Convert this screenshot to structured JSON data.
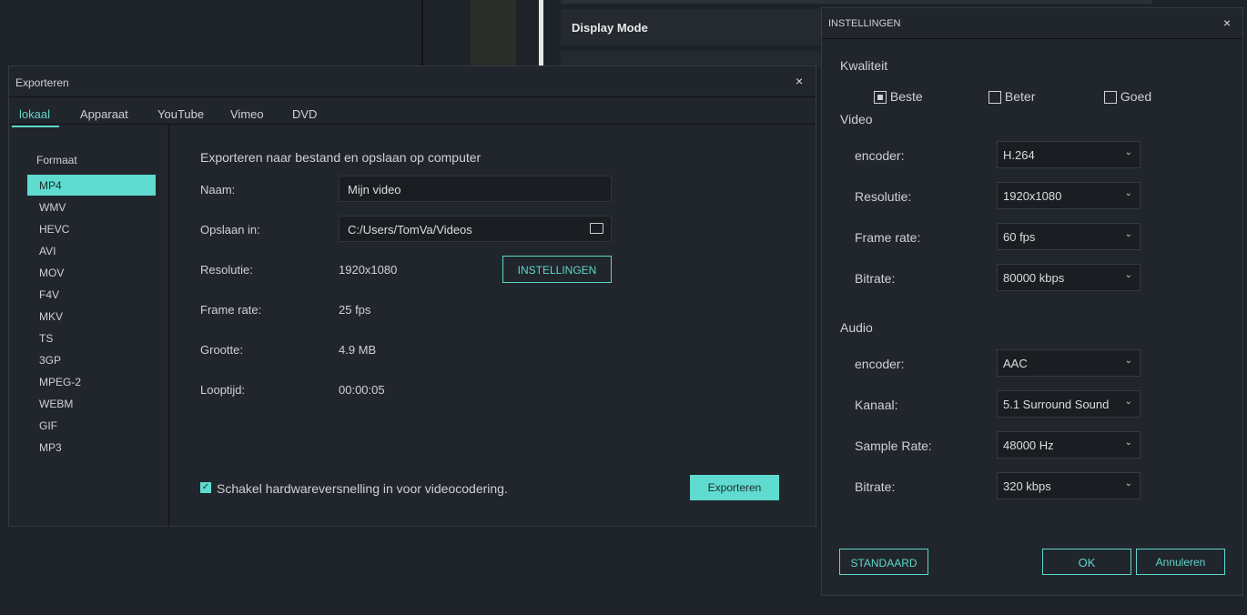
{
  "background": {
    "display_mode": "Display Mode"
  },
  "export": {
    "title": "Exporteren",
    "tabs": [
      "lokaal",
      "Apparaat",
      "YouTube",
      "Vimeo",
      "DVD"
    ],
    "format_label": "Formaat",
    "formats": [
      "MP4",
      "WMV",
      "HEVC",
      "AVI",
      "MOV",
      "F4V",
      "MKV",
      "TS",
      "3GP",
      "MPEG-2",
      "WEBM",
      "GIF",
      "MP3"
    ],
    "heading": "Exporteren naar bestand en opslaan op computer",
    "name_label": "Naam:",
    "name_value": "Mijn video",
    "save_label": "Opslaan in:",
    "save_value": "C:/Users/TomVa/Videos",
    "res_label": "Resolutie:",
    "res_value": "1920x1080",
    "settings_button": "INSTELLINGEN",
    "fps_label": "Frame rate:",
    "fps_value": "25 fps",
    "size_label": "Grootte:",
    "size_value": "4.9 MB",
    "dur_label": "Looptijd:",
    "dur_value": "00:00:05",
    "hw_label": "Schakel hardwareversnelling in voor videocodering.",
    "export_button": "Exporteren"
  },
  "settings": {
    "title": "INSTELLINGEN",
    "quality_label": "Kwaliteit",
    "quality": [
      "Beste",
      "Beter",
      "Goed"
    ],
    "video_label": "Video",
    "video": [
      {
        "label": "encoder:",
        "value": "H.264"
      },
      {
        "label": "Resolutie:",
        "value": "1920x1080"
      },
      {
        "label": "Frame rate:",
        "value": "60 fps"
      },
      {
        "label": "Bitrate:",
        "value": "80000 kbps"
      }
    ],
    "audio_label": "Audio",
    "audio": [
      {
        "label": "encoder:",
        "value": "AAC"
      },
      {
        "label": "Kanaal:",
        "value": "5.1 Surround Sound"
      },
      {
        "label": "Sample Rate:",
        "value": "48000 Hz"
      },
      {
        "label": "Bitrate:",
        "value": "320 kbps"
      }
    ],
    "standard_button": "STANDAARD",
    "ok_button": "OK",
    "cancel_button": "Annuleren"
  }
}
